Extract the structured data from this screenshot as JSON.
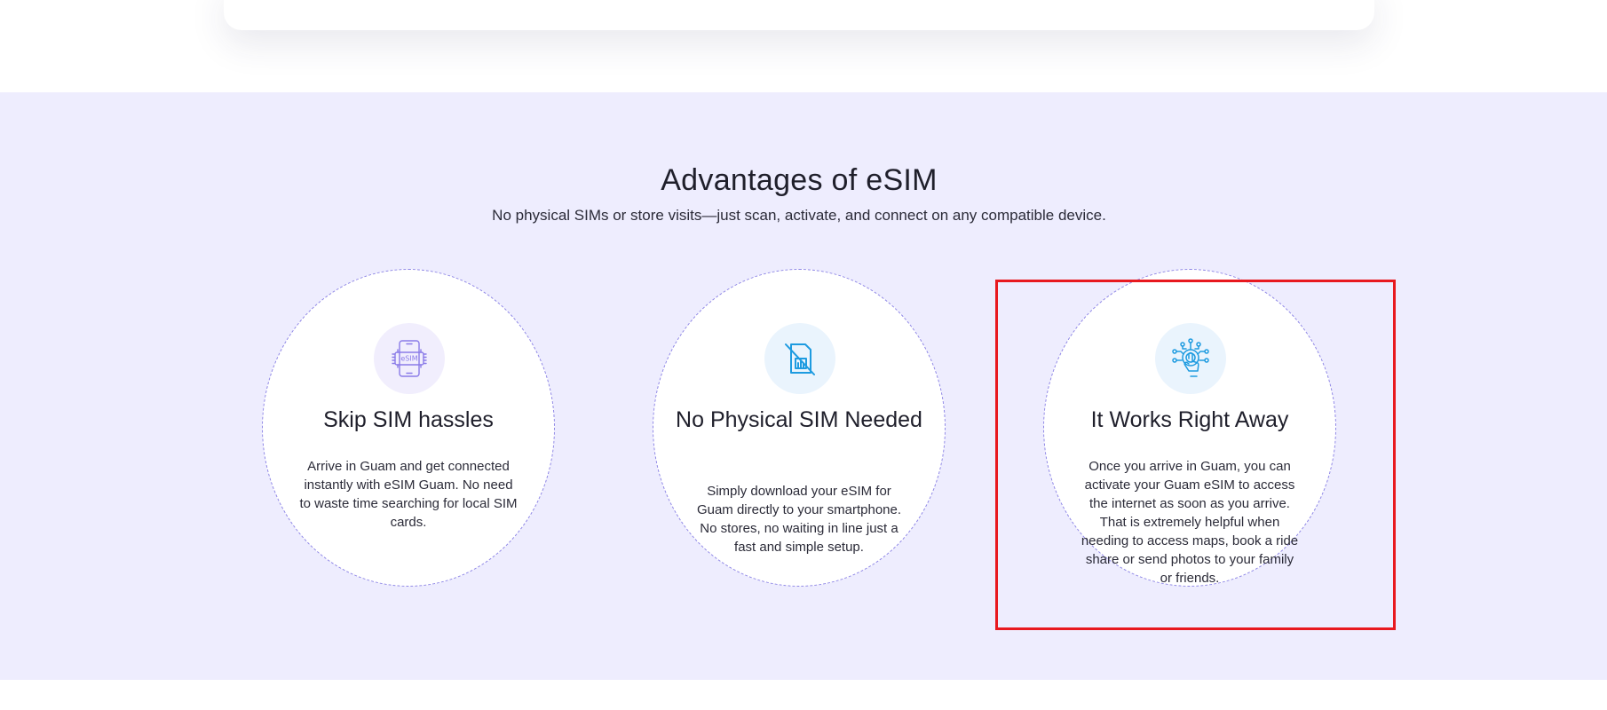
{
  "section": {
    "title": "Advantages of eSIM",
    "subtitle": "No physical SIMs or store visits—just scan, activate, and connect on any compatible device."
  },
  "cards": [
    {
      "icon": "esim-phone-icon",
      "title": "Skip SIM hassles",
      "text": "Arrive in Guam and get connected instantly with eSIM Guam. No need to waste time searching for local SIM cards.",
      "icon_label": "eSIM"
    },
    {
      "icon": "no-sim-card-icon",
      "title": "No Physical SIM Needed",
      "text": "Simply download your eSIM for Guam directly to your smartphone. No stores, no waiting in line just a fast and simple setup."
    },
    {
      "icon": "touch-network-icon",
      "title": "It Works Right Away",
      "text": "Once you arrive in Guam, you can activate your Guam eSIM to access the internet as soon as you arrive. That is extremely helpful when needing to access maps, book a ride share or send photos to your family or friends."
    }
  ],
  "colors": {
    "section_bg": "#eeedfe",
    "card_border": "#8e86e6",
    "icon_purple": "#8a7be8",
    "icon_blue": "#1e9be0",
    "highlight": "#e8191f"
  }
}
